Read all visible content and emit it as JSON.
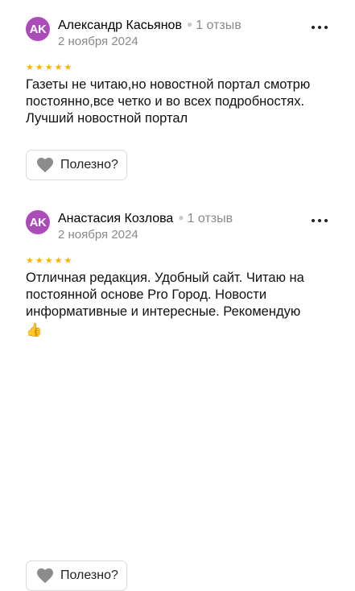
{
  "reviews": [
    {
      "avatar_initials": "AK",
      "avatar_color": "#a94cb8",
      "author": "Александр Касьянов",
      "review_count": "1 отзыв",
      "date": "2 ноября 2024",
      "rating": 5,
      "text": "Газеты не читаю,но новостной портал смотрю постоянно,все четко и во всех подробностях. Лучший новостной портал",
      "useful_label": "Полезно?"
    },
    {
      "avatar_initials": "AK",
      "avatar_color": "#a94cb8",
      "author": "Анастасия Козлова",
      "review_count": "1 отзыв",
      "date": "2 ноября 2024",
      "rating": 5,
      "text": "Отличная редакция. Удобный сайт. Читаю на постоянной основе Pro Город. Новости информативные и интересные. Рекомендую",
      "emoji": "👍",
      "useful_label": "Полезно?"
    }
  ],
  "colors": {
    "star": "#f7b500",
    "heart": "#8c8c8c",
    "muted_text": "#8a8a8a"
  },
  "icons": {
    "more": "more-dots-icon",
    "useful": "heart-icon",
    "star": "star-icon"
  }
}
